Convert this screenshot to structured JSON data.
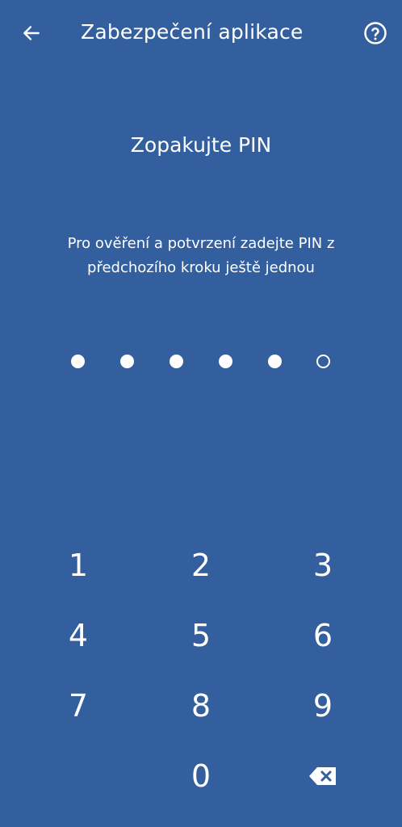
{
  "app_bar": {
    "title": "Zabezpečení aplikace",
    "back_icon": "arrow-left-icon",
    "help_icon": "help-circle-icon"
  },
  "heading": "Zopakujte PIN",
  "instruction": "Pro ověření a potvrzení zadejte PIN z předchozího kroku ještě jednou",
  "pin": {
    "length": 6,
    "entered": 5
  },
  "keypad": {
    "k1": "1",
    "k2": "2",
    "k3": "3",
    "k4": "4",
    "k5": "5",
    "k6": "6",
    "k7": "7",
    "k8": "8",
    "k9": "9",
    "k0": "0",
    "backspace_icon": "backspace-icon"
  },
  "colors": {
    "background": "#335f9f",
    "foreground": "#ffffff"
  }
}
